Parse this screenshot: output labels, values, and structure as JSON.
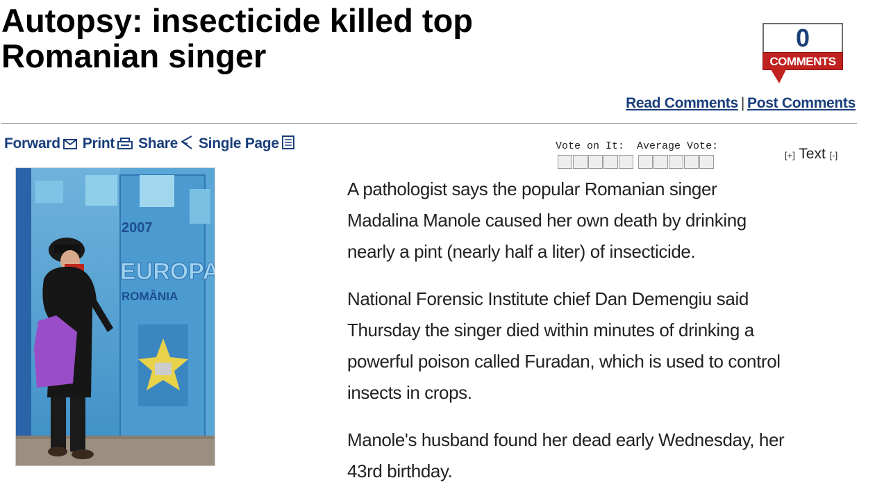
{
  "article": {
    "title_line1": "Autopsy: insecticide killed top",
    "title_line2": "Romanian singer",
    "paragraphs": [
      [
        "A pathologist says the popular Romanian singer",
        "Madalina Manole caused her own death by drinking",
        "nearly a pint (nearly half a liter) of insecticide."
      ],
      [
        "National Forensic Institute chief Dan Demengiu said",
        "Thursday the singer died within minutes of drinking a",
        "powerful poison called Furadan, which is used to control",
        "insects in crops."
      ],
      [
        "Manole's husband found her dead early Wednesday, her",
        "43rd birthday."
      ]
    ]
  },
  "comments": {
    "count": "0",
    "label": "COMMENTS",
    "read_label": "Read Comments",
    "separator": "|",
    "post_label": "Post Comments"
  },
  "toolbar": {
    "forward_label": "Forward",
    "print_label": "Print",
    "share_label": "Share",
    "single_page_label": "Single Page",
    "icons": [
      "envelope-icon",
      "printer-icon",
      "share-icon",
      "page-icon"
    ]
  },
  "vote": {
    "vote_label": "Vote on It:",
    "average_label": "Average Vote:",
    "vote_slots": 5,
    "average_slots": 5
  },
  "text_size": {
    "increase_label": "[+]",
    "label": "Text",
    "decrease_label": "[-]"
  },
  "photo": {
    "year_text": "2007",
    "poster_big_text": "EUROPA",
    "country_text": "ROMÂNIA"
  },
  "colors": {
    "link": "#1a3e7c",
    "comment_red": "#c0221f",
    "comment_number": "#1c3f7a"
  }
}
